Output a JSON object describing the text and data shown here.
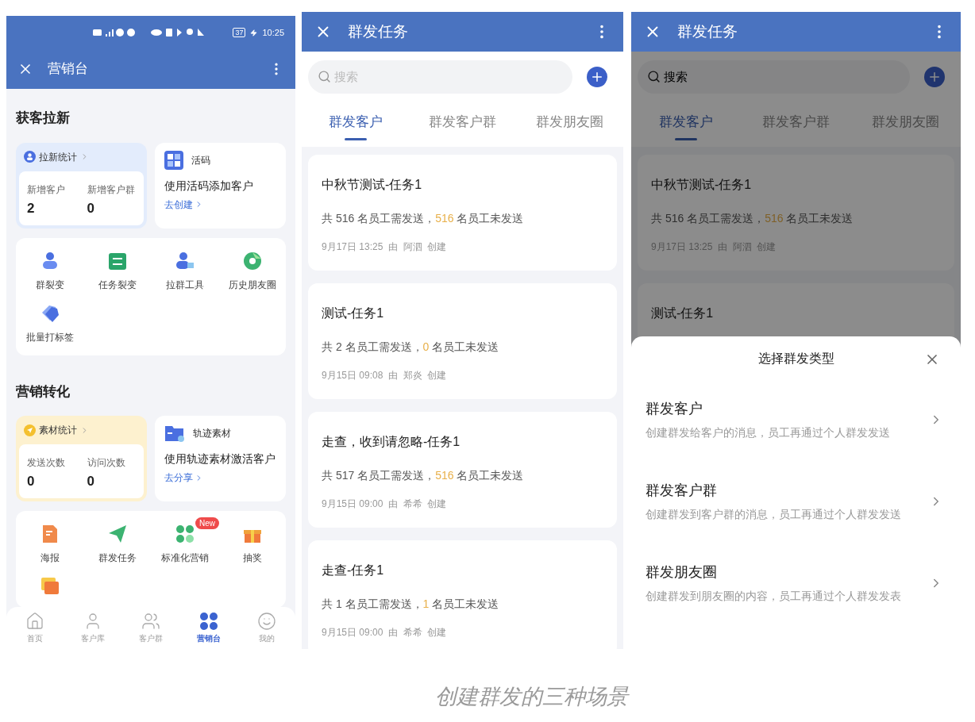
{
  "marketing_screen": {
    "status_bar": {
      "time": "10:25",
      "battery": "37"
    },
    "title": "营销台",
    "sections": [
      {
        "title": "获客拉新",
        "stats_card": {
          "kind": "leads",
          "title": "拉新统计",
          "stats": [
            {
              "label": "新增客户",
              "value": "2"
            },
            {
              "label": "新增客户群",
              "value": "0"
            }
          ]
        },
        "feature_card": {
          "name": "活码",
          "headline": "使用活码添加客户",
          "link": "去创建"
        },
        "tools": [
          {
            "kind": "tool",
            "label": "群裂变"
          },
          {
            "kind": "tool",
            "label": "任务裂变"
          },
          {
            "kind": "tool",
            "label": "拉群工具"
          },
          {
            "kind": "tool",
            "label": "历史朋友圈"
          },
          {
            "kind": "tool",
            "label": "批量打标签"
          }
        ]
      },
      {
        "title": "营销转化",
        "stats_card": {
          "kind": "materials",
          "title": "素材统计",
          "stats": [
            {
              "label": "发送次数",
              "value": "0"
            },
            {
              "label": "访问次数",
              "value": "0"
            }
          ]
        },
        "feature_card": {
          "name": "轨迹素材",
          "headline": "使用轨迹素材激活客户",
          "link": "去分享"
        },
        "tools": [
          {
            "kind": "tool",
            "label": "海报"
          },
          {
            "kind": "tool",
            "label": "群发任务"
          },
          {
            "kind": "tool",
            "label": "标准化营销",
            "badge": "New"
          },
          {
            "kind": "tool",
            "label": "抽奖"
          },
          {
            "kind": "icon_only"
          }
        ]
      }
    ],
    "nav": [
      {
        "label": "首页",
        "selected": false
      },
      {
        "label": "客户库",
        "selected": false
      },
      {
        "label": "客户群",
        "selected": false
      },
      {
        "label": "营销台",
        "selected": true
      },
      {
        "label": "我的",
        "selected": false
      }
    ]
  },
  "task_screen": {
    "title": "群发任务",
    "search": {
      "placeholder": "搜索"
    },
    "tabs": [
      {
        "label": "群发客户",
        "selected": true
      },
      {
        "label": "群发客户群",
        "selected": false
      },
      {
        "label": "群发朋友圈",
        "selected": false
      }
    ],
    "tasks": [
      {
        "title": "中秋节测试-任务1",
        "needed": "共 516 名员工需发送，",
        "unsent": "516",
        "unsent_suffix": "名员工未发送",
        "date": "9月17日 13:25",
        "by": "由",
        "creator": "阿泗",
        "action": "创建"
      },
      {
        "title": "测试-任务1",
        "needed": "共 2 名员工需发送，",
        "unsent": "0",
        "unsent_suffix": "名员工未发送",
        "date": "9月15日 09:08",
        "by": "由",
        "creator": "郑炎",
        "action": "创建"
      },
      {
        "title": "走查，收到请忽略-任务1",
        "needed": "共 517 名员工需发送，",
        "unsent": "516",
        "unsent_suffix": "名员工未发送",
        "date": "9月15日 09:00",
        "by": "由",
        "creator": "希希",
        "action": "创建"
      },
      {
        "title": "走查-任务1",
        "needed": "共 1 名员工需发送，",
        "unsent": "1",
        "unsent_suffix": "名员工未发送",
        "date": "9月15日 09:00",
        "by": "由",
        "creator": "希希",
        "action": "创建"
      }
    ]
  },
  "task_screen_with_sheet": {
    "title": "群发任务",
    "search": {
      "placeholder": "搜索"
    },
    "tabs": [
      {
        "label": "群发客户",
        "selected": true
      },
      {
        "label": "群发客户群",
        "selected": false
      },
      {
        "label": "群发朋友圈",
        "selected": false
      }
    ],
    "tasks": [
      {
        "title": "中秋节测试-任务1",
        "needed": "共 516 名员工需发送，",
        "unsent": "516",
        "unsent_suffix": "名员工未发送",
        "date": "9月17日 13:25",
        "by": "由",
        "creator": "阿泗",
        "action": "创建"
      },
      {
        "title": "测试-任务1"
      }
    ],
    "sheet": {
      "title": "选择群发类型",
      "options": [
        {
          "title": "群发客户",
          "description": "创建群发给客户的消息，员工再通过个人群发发送"
        },
        {
          "title": "群发客户群",
          "description": "创建群发到客户群的消息，员工再通过个人群发发送"
        },
        {
          "title": "群发朋友圈",
          "description": "创建群发到朋友圈的内容，员工再通过个人群发发表"
        }
      ]
    }
  },
  "caption": "创建群发的三种场景"
}
